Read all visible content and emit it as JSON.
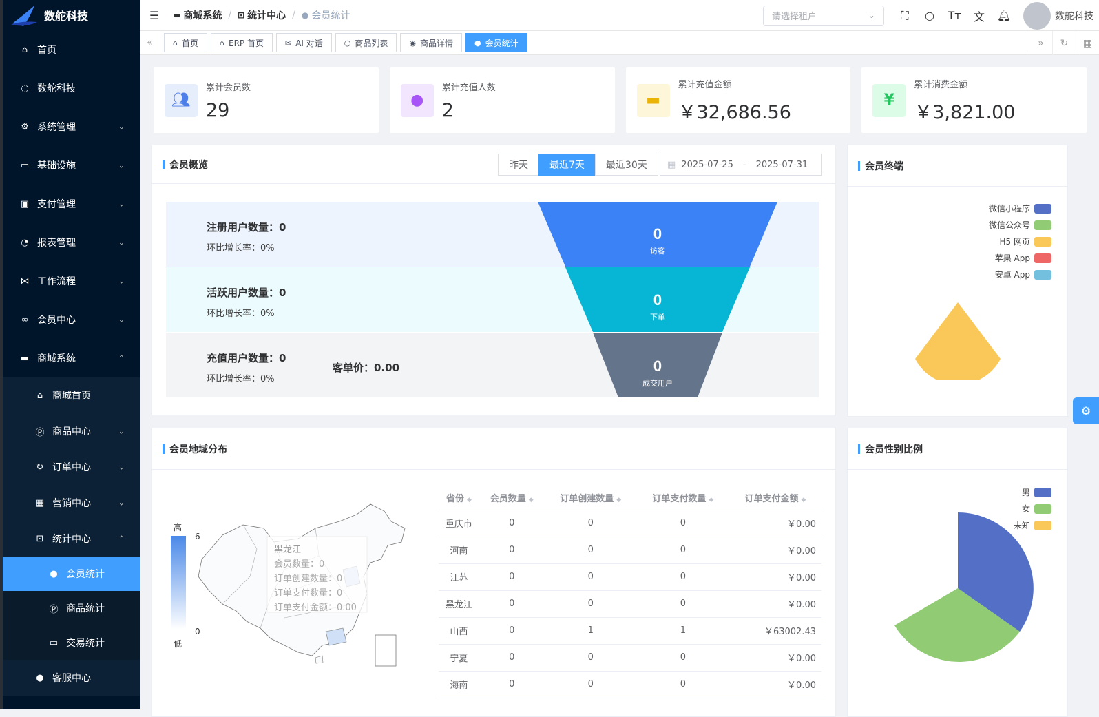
{
  "app": {
    "name": "数舵科技"
  },
  "sidebar": {
    "items": [
      {
        "label": "首页",
        "icon": "home-icon"
      },
      {
        "label": "数舵科技",
        "icon": "chat-icon"
      },
      {
        "label": "系统管理",
        "icon": "gear-icon"
      },
      {
        "label": "基础设施",
        "icon": "monitor-icon"
      },
      {
        "label": "支付管理",
        "icon": "payment-icon"
      },
      {
        "label": "报表管理",
        "icon": "pie-icon"
      },
      {
        "label": "工作流程",
        "icon": "workflow-icon"
      },
      {
        "label": "会员中心",
        "icon": "bike-icon"
      },
      {
        "label": "商城系统",
        "icon": "shop-icon"
      }
    ],
    "shop_sub": [
      {
        "label": "商城首页"
      },
      {
        "label": "商品中心"
      },
      {
        "label": "订单中心"
      },
      {
        "label": "营销中心"
      },
      {
        "label": "统计中心"
      }
    ],
    "stat_sub": [
      {
        "label": "会员统计"
      },
      {
        "label": "商品统计"
      },
      {
        "label": "交易统计"
      }
    ],
    "service": {
      "label": "客服中心"
    }
  },
  "header": {
    "breadcrumb": [
      "商城系统",
      "统计中心",
      "会员统计"
    ],
    "tenant_placeholder": "请选择租户",
    "username": "数舵科技"
  },
  "tabs": [
    {
      "label": "首页"
    },
    {
      "label": "ERP 首页"
    },
    {
      "label": "AI 对话"
    },
    {
      "label": "商品列表"
    },
    {
      "label": "商品详情"
    },
    {
      "label": "会员统计"
    }
  ],
  "stats": [
    {
      "label": "累计会员数",
      "value": "29",
      "color": "#4e7ee8",
      "bg": "#e6eefc"
    },
    {
      "label": "累计充值人数",
      "value": "2",
      "color": "#a855f7",
      "bg": "#f1e6fd"
    },
    {
      "label": "累计充值金额",
      "value": "￥32,686.56",
      "color": "#eab308",
      "bg": "#fef6d8"
    },
    {
      "label": "累计消费金额",
      "value": "￥3,821.00",
      "color": "#22c55e",
      "bg": "#dcfce7"
    }
  ],
  "overview": {
    "title": "会员概览",
    "ranges": [
      "昨天",
      "最近7天",
      "最近30天"
    ],
    "date_start": "2025-07-25",
    "date_sep": "-",
    "date_end": "2025-07-31",
    "rows": [
      {
        "title": "注册用户数量：0",
        "rate": "环比增长率：0%"
      },
      {
        "title": "活跃用户数量：0",
        "rate": "环比增长率：0%"
      },
      {
        "title": "充值用户数量：0",
        "rate": "环比增长率：0%"
      }
    ],
    "unit_price": "客单价：0.00",
    "funnel": [
      {
        "value": "0",
        "label": "访客",
        "color": "#3b82f6"
      },
      {
        "value": "0",
        "label": "下单",
        "color": "#06b6d4"
      },
      {
        "value": "0",
        "label": "成交用户",
        "color": "#64748b"
      }
    ]
  },
  "terminal": {
    "title": "会员终端",
    "legend": [
      {
        "name": "微信小程序",
        "color": "#5470c6"
      },
      {
        "name": "微信公众号",
        "color": "#91cc75"
      },
      {
        "name": "H5 网页",
        "color": "#fac858"
      },
      {
        "name": "苹果 App",
        "color": "#ee6666"
      },
      {
        "name": "安卓 App",
        "color": "#73c0de"
      }
    ]
  },
  "region": {
    "title": "会员地域分布",
    "scale_high": "高",
    "scale_low": "低",
    "scale_max": "6",
    "scale_min": "0",
    "tooltip": [
      "黑龙江",
      "会员数量：0",
      "订单创建数量：0",
      "订单支付数量：0",
      "订单支付金额：0.00"
    ],
    "columns": [
      "省份",
      "会员数量",
      "订单创建数量",
      "订单支付数量",
      "订单支付金额"
    ],
    "rows": [
      [
        "重庆市",
        "0",
        "0",
        "0",
        "￥0.00"
      ],
      [
        "河南",
        "0",
        "0",
        "0",
        "￥0.00"
      ],
      [
        "江苏",
        "0",
        "0",
        "0",
        "￥0.00"
      ],
      [
        "黑龙江",
        "0",
        "0",
        "0",
        "￥0.00"
      ],
      [
        "山西",
        "0",
        "1",
        "1",
        "￥63002.43"
      ],
      [
        "宁夏",
        "0",
        "0",
        "0",
        "￥0.00"
      ],
      [
        "海南",
        "0",
        "0",
        "0",
        "￥0.00"
      ]
    ]
  },
  "gender": {
    "title": "会员性别比例",
    "legend": [
      {
        "name": "男",
        "color": "#5470c6"
      },
      {
        "name": "女",
        "color": "#91cc75"
      },
      {
        "name": "未知",
        "color": "#fac858"
      }
    ]
  }
}
